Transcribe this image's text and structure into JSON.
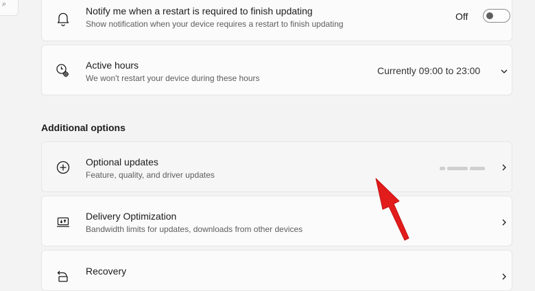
{
  "colors": {
    "background": "#f3f3f3",
    "card": "#fbfbfb",
    "border": "#e6e6e6",
    "annotation_arrow": "#e21b1b"
  },
  "search": {
    "icon": "search-icon"
  },
  "cards": [
    {
      "title": "Notify me when a restart is required to finish updating",
      "subtitle": "Show notification when your device requires a restart to finish updating",
      "icon": "bell-icon",
      "toggle_label": "Off",
      "toggle_on": false
    },
    {
      "title": "Active hours",
      "subtitle": "We won't restart your device during these hours",
      "icon": "clock-settings-icon",
      "value": "Currently 09:00 to 23:00",
      "control_icon": "chevron-down-icon"
    }
  ],
  "additional_options": {
    "heading": "Additional options",
    "items": [
      {
        "title": "Optional updates",
        "subtitle": "Feature, quality, and driver updates",
        "icon": "plus-circle-icon",
        "control_icon": "chevron-right-icon"
      },
      {
        "title": "Delivery Optimization",
        "subtitle": "Bandwidth limits for updates, downloads from other devices",
        "icon": "delivery-optimization-icon",
        "control_icon": "chevron-right-icon"
      },
      {
        "title": "Recovery",
        "icon": "recovery-icon",
        "control_icon": "chevron-right-icon"
      }
    ]
  },
  "annotation": {
    "icon": "red-arrow-icon"
  }
}
